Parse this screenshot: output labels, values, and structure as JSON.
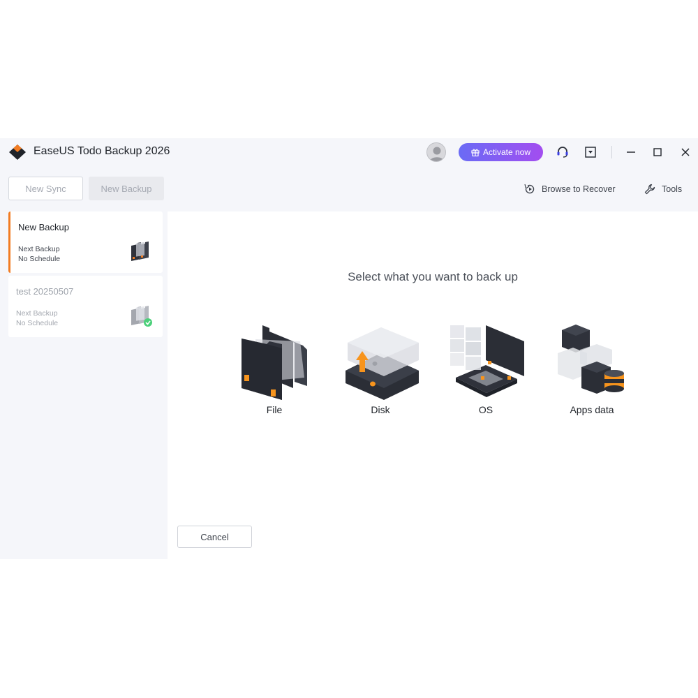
{
  "window": {
    "title": "EaseUS Todo Backup 2026"
  },
  "header": {
    "activate_label": "Activate now"
  },
  "toolbar": {
    "new_sync_label": "New Sync",
    "new_backup_label": "New Backup",
    "browse_to_recover_label": "Browse to Recover",
    "tools_label": "Tools"
  },
  "sidebar": {
    "items": [
      {
        "title": "New Backup",
        "next_label": "Next Backup",
        "schedule": "No Schedule"
      },
      {
        "title": "test 20250507",
        "next_label": "Next Backup",
        "schedule": "No Schedule"
      }
    ]
  },
  "main": {
    "prompt": "Select what you want to back up",
    "options": [
      {
        "label": "File",
        "icon": "folder-icon"
      },
      {
        "label": "Disk",
        "icon": "disk-icon"
      },
      {
        "label": "OS",
        "icon": "os-icon"
      },
      {
        "label": "Apps data",
        "icon": "apps-data-icon"
      }
    ],
    "cancel_label": "Cancel"
  },
  "colors": {
    "accent": "#f27c22",
    "activate_start": "#6a6bf5",
    "activate_end": "#a34df0",
    "success": "#4cd07a"
  }
}
